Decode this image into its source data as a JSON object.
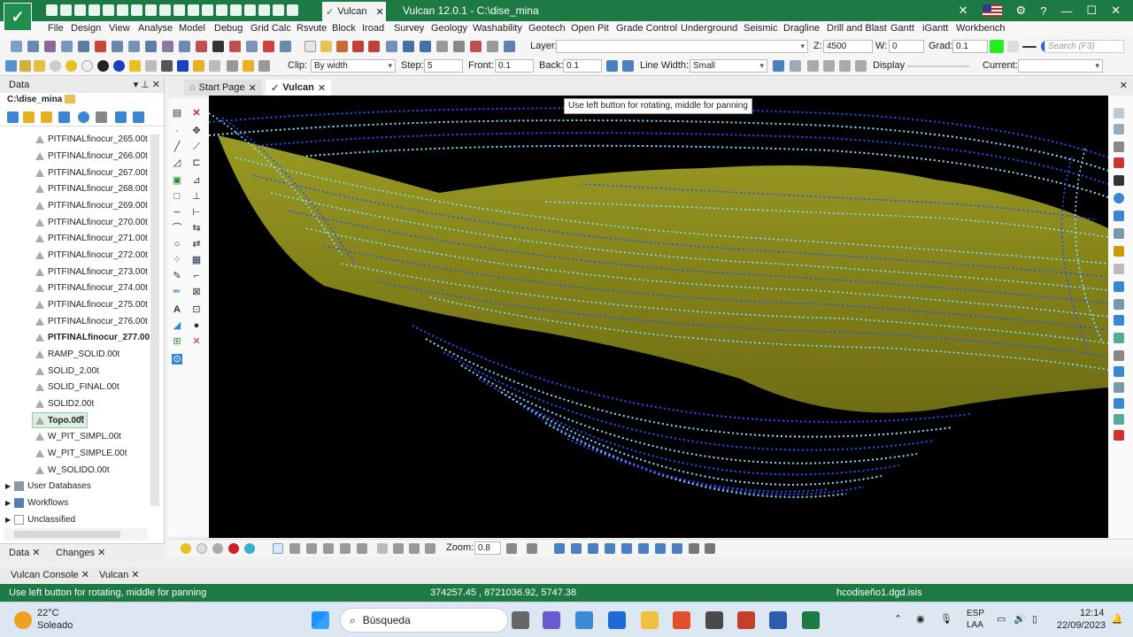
{
  "titlebar": {
    "tab_label": "Vulcan",
    "window_title": "Vulcan 12.0.1 - C:\\dise_mina"
  },
  "menu": [
    "File",
    "Design",
    "View",
    "Analyse",
    "Model",
    "Debug",
    "Grid Calc",
    "Rsvute",
    "Block",
    "Iroad",
    "Survey",
    "Geology",
    "Washability",
    "Geotech",
    "Open Pit",
    "Grade Control",
    "Underground",
    "Seismic",
    "Dragline",
    "Drill and Blast",
    "Gantt",
    "iGantt",
    "Workbench"
  ],
  "toolbar1": {
    "layer_label": "Layer:",
    "z_label": "Z:",
    "z_value": "4500",
    "w_label": "W:",
    "w_value": "0",
    "grad_label": "Grad:",
    "grad_value": "0.1",
    "search_placeholder": "Search (F3)"
  },
  "toolbar2": {
    "clip_label": "Clip:",
    "clip_value": "By width",
    "step_label": "Step:",
    "step_value": "5",
    "front_label": "Front:",
    "front_value": "0.1",
    "back_label": "Back:",
    "back_value": "0.1",
    "linewidth_label": "Line Width:",
    "linewidth_value": "Small",
    "display_label": "Display",
    "current_label": "Current:"
  },
  "data_panel": {
    "title": "Data",
    "path": "C:\\dise_mina",
    "items": [
      "PITFINALfinocur_265.00t",
      "PITFINALfinocur_266.00t",
      "PITFINALfinocur_267.00t",
      "PITFINALfinocur_268.00t",
      "PITFINALfinocur_269.00t",
      "PITFINALfinocur_270.00t",
      "PITFINALfinocur_271.00t",
      "PITFINALfinocur_272.00t",
      "PITFINALfinocur_273.00t",
      "PITFINALfinocur_274.00t",
      "PITFINALfinocur_275.00t",
      "PITFINALfinocur_276.00t",
      "PITFINALfinocur_277.00",
      "RAMP_SOLID.00t",
      "SOLID_2.00t",
      "SOLID_FINAL.00t",
      "SOLID2.00t",
      "Topo.00t",
      "W_PIT_SIMPL.00t",
      "W_PIT_SIMPLE.00t",
      "W_SOLIDO.00t"
    ],
    "groups": [
      "User Databases",
      "Workflows",
      "Unclassified"
    ],
    "tabs": [
      "Data",
      "Changes"
    ]
  },
  "doc_tabs": [
    "Start Page",
    "Vulcan"
  ],
  "tooltip": "Use left button for rotating, middle for panning",
  "bottom_toolbar": {
    "zoom_label": "Zoom:",
    "zoom_value": "0.8"
  },
  "bottom_tabs": [
    "Vulcan Console",
    "Vulcan"
  ],
  "status": {
    "message": "Use left button for rotating, middle for panning",
    "coords": "374257.45 , 8721036.92, 5747.38",
    "file": "hcodiseño1.dgd.isis"
  },
  "taskbar": {
    "temperature": "22°C",
    "weather": "Soleado",
    "search_label": "Búsqueda",
    "lang1": "ESP",
    "lang2": "LAA",
    "time": "12:14",
    "date": "22/09/2023"
  },
  "colors": {
    "brand_green": "#1e7a44",
    "terrain": "#8b8a1c",
    "contour_cyan": "#7fe3ff",
    "contour_blue": "#2a4cff"
  }
}
